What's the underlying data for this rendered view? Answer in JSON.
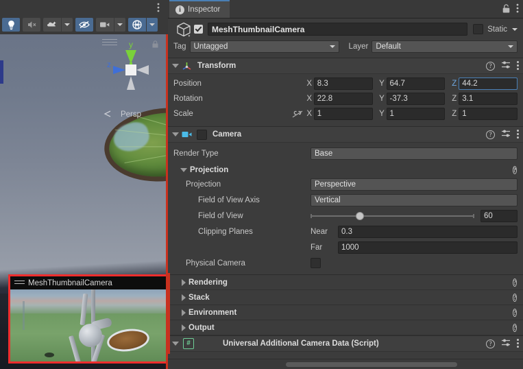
{
  "scene_view": {
    "toolbar": [
      {
        "name": "lighting-toggle",
        "icon": "lightbulb-icon",
        "active": true,
        "has_dropdown": false
      },
      {
        "name": "audio-toggle",
        "icon": "speaker-mute-icon",
        "active": false,
        "has_dropdown": false
      },
      {
        "name": "effects-toggle",
        "icon": "fx-cloud-icon",
        "active": false,
        "has_dropdown": true
      },
      {
        "name": "hidden-objects-toggle",
        "icon": "eye-slash-icon",
        "active": true,
        "has_dropdown": false
      },
      {
        "name": "scene-camera-settings",
        "icon": "camera-icon",
        "active": false,
        "has_dropdown": true
      },
      {
        "name": "gizmos-toggle",
        "icon": "gizmo-globe-icon",
        "active": true,
        "has_dropdown": true
      }
    ],
    "gizmo": {
      "y_axis_label": "y",
      "z_axis_label": "z",
      "projection_label": "Persp",
      "y_color": "#7ad13a",
      "z_color": "#3f6fd8",
      "neutral_color": "#c9cbd0"
    },
    "camera_preview": {
      "title": "MeshThumbnailCamera",
      "border_color": "#ef2d2d"
    }
  },
  "inspector": {
    "tab": {
      "label": "Inspector",
      "icon": "info-icon",
      "lock_icon": "lock-icon",
      "menu_icon": "kebab-menu-icon"
    },
    "object_header": {
      "icon": "prefab-cube-icon",
      "enabled": true,
      "name": "MeshThumbnailCamera",
      "static_label": "Static",
      "static_checked": false,
      "tag_label": "Tag",
      "tag_value": "Untagged",
      "layer_label": "Layer",
      "layer_value": "Default"
    },
    "transform": {
      "title": "Transform",
      "icon": "transform-axis-icon",
      "expanded": true,
      "rows": [
        {
          "label": "Position",
          "x": "8.3",
          "y": "64.7",
          "z": "44.2",
          "z_focused": true,
          "link": false
        },
        {
          "label": "Rotation",
          "x": "22.8",
          "y": "-37.3",
          "z": "3.1",
          "z_focused": false,
          "link": false
        },
        {
          "label": "Scale",
          "x": "1",
          "y": "1",
          "z": "1",
          "z_focused": false,
          "link": true,
          "link_icon": "broken-link-icon"
        }
      ],
      "axis_labels": {
        "x": "X",
        "y": "Y",
        "z": "Z"
      }
    },
    "camera": {
      "title": "Camera",
      "icon": "camera-component-icon",
      "enabled": false,
      "expanded": true,
      "render_type_label": "Render Type",
      "render_type_value": "Base",
      "projection_section_label": "Projection",
      "projection_label": "Projection",
      "projection_value": "Perspective",
      "fov_axis_label": "Field of View Axis",
      "fov_axis_value": "Vertical",
      "fov_label": "Field of View",
      "fov_value": "60",
      "fov_slider_percent": 30,
      "clipping_planes_label": "Clipping Planes",
      "near_label": "Near",
      "near_value": "0.3",
      "far_label": "Far",
      "far_value": "1000",
      "physical_camera_label": "Physical Camera",
      "physical_camera_checked": false
    },
    "collapsed_sections": [
      {
        "label": "Rendering",
        "name": "rendering"
      },
      {
        "label": "Stack",
        "name": "stack"
      },
      {
        "label": "Environment",
        "name": "environment"
      },
      {
        "label": "Output",
        "name": "output"
      }
    ],
    "script_component": {
      "title": "Universal Additional Camera Data (Script)",
      "icon": "script-icon",
      "expanded": true
    },
    "icons": {
      "help": "?",
      "preset": "preset-sliders-icon",
      "menu": "kebab-menu-icon"
    }
  }
}
